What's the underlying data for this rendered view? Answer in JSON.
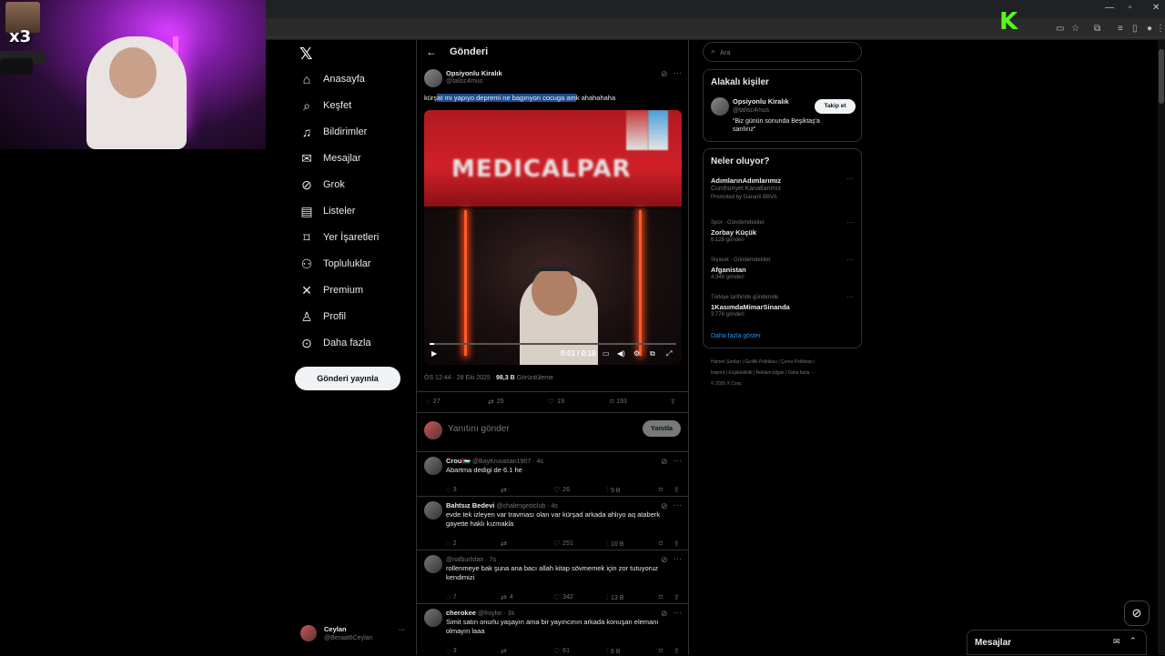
{
  "nav": {
    "items": [
      {
        "label": "Anasayfa",
        "icon": "home-icon",
        "glyph": "⌂"
      },
      {
        "label": "Keşfet",
        "icon": "search-icon",
        "glyph": "⌕"
      },
      {
        "label": "Bildirimler",
        "icon": "bell-icon",
        "glyph": "♫"
      },
      {
        "label": "Mesajlar",
        "icon": "mail-icon",
        "glyph": "✉"
      },
      {
        "label": "Grok",
        "icon": "grok-icon",
        "glyph": "⊘"
      },
      {
        "label": "Listeler",
        "icon": "list-icon",
        "glyph": "▤"
      },
      {
        "label": "Yer İşaretleri",
        "icon": "bookmark-icon",
        "glyph": "⌑"
      },
      {
        "label": "Topluluklar",
        "icon": "communities-icon",
        "glyph": "⚇"
      },
      {
        "label": "Premium",
        "icon": "x-icon",
        "glyph": "✕"
      },
      {
        "label": "Profil",
        "icon": "profile-icon",
        "glyph": "♙"
      },
      {
        "label": "Daha fazla",
        "icon": "more-circle-icon",
        "glyph": "⊙"
      }
    ],
    "post_button": "Gönderi yayınla",
    "me": {
      "name": "Ceylan",
      "handle": "@Beraat6Ceylan"
    }
  },
  "overlay": {
    "badge": "x3"
  },
  "header": {
    "title": "Gönderi"
  },
  "post": {
    "author_name": "Opsiyonlu Kiralık",
    "author_handle": "@talisc4mus",
    "text_pre": "kürş",
    "text_highlight": "at mı yapıyo depremi ne bagırıyon cocuga am",
    "text_post": "k ahahahaha",
    "video_time": "0:01 / 0:18",
    "media_banner": "MEDICALPAR",
    "meta_time": "ÖS 12:44 · 28 Eki 2025 · ",
    "views": "98,3 B",
    "views_label": " Görüntüleme",
    "replies": "27",
    "reposts": "25",
    "likes": "19",
    "bookmarks": "193"
  },
  "reply_box": {
    "placeholder": "Yanıtını gönder",
    "button": "Yanıtla"
  },
  "replies": [
    {
      "name": "Crou🇵🇸",
      "handle": "@BayKruvasan1907 · 4s",
      "text": "Abartma dedigi de 6.1 he",
      "text2": "",
      "replies": "3",
      "reposts": "",
      "likes": "26",
      "views": "9 B"
    },
    {
      "name": "Bahtsız Bedevi",
      "handle": "@chalengestclub · 4s",
      "text": "evde tek izleyen var travması olan var kürşad arkada ahlıyo aq ataberk",
      "text2": "gayette haklı kızmakla",
      "replies": "2",
      "reposts": "",
      "likes": "251",
      "views": "10 B"
    },
    {
      "name": "",
      "handle": "@nalburlstan · 7s",
      "text": "rollenmeye bak şuna ana bacı allah kitap sövmemek için zor tutuyoruz",
      "text2": "kendimizi",
      "replies": "7",
      "reposts": "4",
      "likes": "342",
      "views": "13 B"
    },
    {
      "name": "cherokee",
      "handle": "@froylor · 3s",
      "text": "Simit satın onurlu yaşayın ama bir yayıncının arkada konuşan elemanı",
      "text2": "olmayın laaa",
      "replies": "3",
      "reposts": "",
      "likes": "61",
      "views": "6 B"
    }
  ],
  "right": {
    "search_placeholder": "Ara",
    "related_title": "Alakalı kişiler",
    "related": {
      "name": "Opsiyonlu Kiralık",
      "handle": "@talisc4mus",
      "bio": "“Biz günün sonunda Beşiktaş'a sarılırız”",
      "follow": "Takip et"
    },
    "trends_title": "Neler oluyor?",
    "trends": [
      {
        "context": "",
        "title": "AdımlarınAdımlarımız",
        "sub": "Cumhuriyet Kanatlarımız",
        "count": "Promoted by Garanti BBVA"
      },
      {
        "context": "Spor · Gündemdekiler",
        "title": "Zorbay Küçük",
        "sub": "",
        "count": "6.128 gönderi"
      },
      {
        "context": "Siyaset · Gündemdekiler",
        "title": "Afganistan",
        "sub": "",
        "count": "4.348 gönderi"
      },
      {
        "context": "Türkiye tarihinde gündemde",
        "title": "1KasımdaMimarSinanda",
        "sub": "",
        "count": "3.776 gönderi"
      }
    ],
    "show_more": "Daha fazla göster",
    "footer": [
      "Hizmet Şartları  |  Gizlilik Politikası  |  Çerez Politikası  |",
      "Imprint  |  Erişilebilirlik  |  Reklam bilgisi  |  Daha fazla ···",
      "© 2025 X Corp."
    ]
  },
  "messages_bar": {
    "label": "Mesajlar"
  },
  "colors": {
    "accent": "#1d9bf0",
    "kick": "#53fc18",
    "highlight": "#1d4f91"
  }
}
